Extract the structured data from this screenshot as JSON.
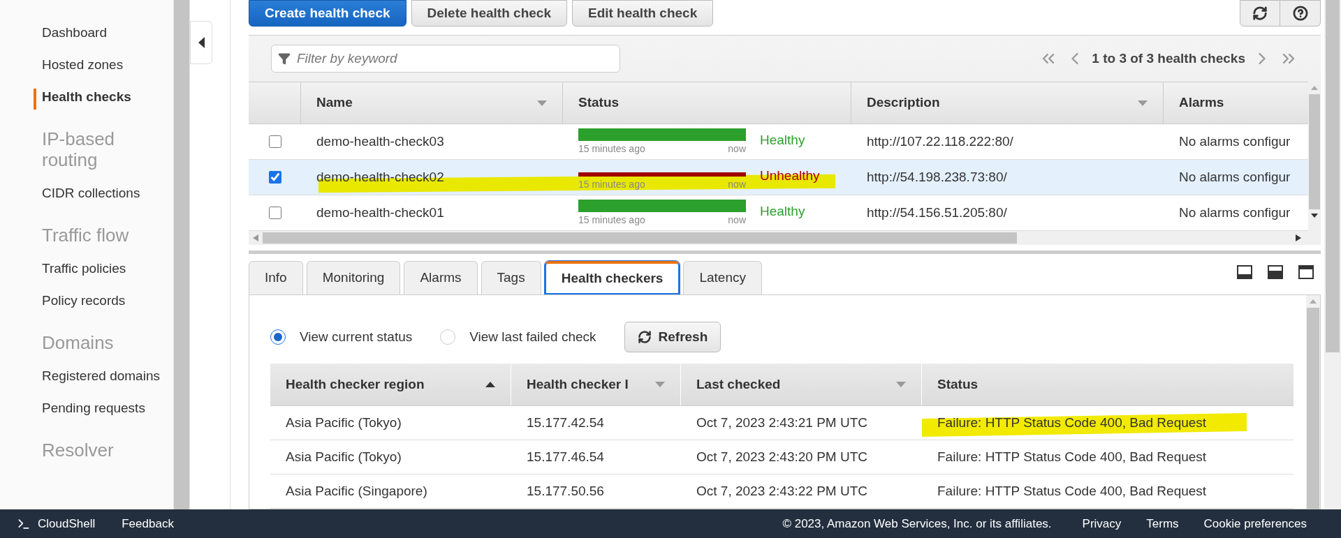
{
  "sidebar": {
    "items": [
      {
        "kind": "link",
        "label": "Dashboard",
        "selected": false
      },
      {
        "kind": "link",
        "label": "Hosted zones",
        "selected": false
      },
      {
        "kind": "link",
        "label": "Health checks",
        "selected": true
      },
      {
        "kind": "heading",
        "label": "IP-based routing"
      },
      {
        "kind": "link",
        "label": "CIDR collections",
        "selected": false
      },
      {
        "kind": "heading",
        "label": "Traffic flow"
      },
      {
        "kind": "link",
        "label": "Traffic policies",
        "selected": false
      },
      {
        "kind": "link",
        "label": "Policy records",
        "selected": false
      },
      {
        "kind": "heading",
        "label": "Domains"
      },
      {
        "kind": "link",
        "label": "Registered domains",
        "selected": false
      },
      {
        "kind": "link",
        "label": "Pending requests",
        "selected": false
      },
      {
        "kind": "heading",
        "label": "Resolver"
      }
    ]
  },
  "toolbar": {
    "buttons": [
      {
        "kind": "primary",
        "label": "Create health check"
      },
      {
        "kind": "default",
        "label": "Delete health check"
      },
      {
        "kind": "default",
        "label": "Edit health check"
      }
    ]
  },
  "table": {
    "filter": {
      "placeholder": "Filter by keyword"
    },
    "pagination": "1 to 3 of 3 health checks",
    "columns": [
      "Name",
      "Status",
      "Description",
      "Alarms"
    ],
    "rows": [
      {
        "checked": false,
        "highlighted": false,
        "name": "demo-health-check03",
        "kind": "healthy",
        "status_label": "Healthy",
        "from": "15 minutes ago",
        "to": "now",
        "description": "http://107.22.118.222:80/",
        "alarms": "No alarms configur"
      },
      {
        "checked": true,
        "highlighted": true,
        "name": "demo-health-check02",
        "kind": "unhealthy",
        "status_label": "Unhealthy",
        "from": "15 minutes ago",
        "to": "now",
        "description": "http://54.198.238.73:80/",
        "alarms": "No alarms configur"
      },
      {
        "checked": false,
        "highlighted": false,
        "name": "demo-health-check01",
        "kind": "healthy",
        "status_label": "Healthy",
        "from": "15 minutes ago",
        "to": "now",
        "description": "http://54.156.51.205:80/",
        "alarms": "No alarms configur"
      }
    ]
  },
  "tabs": [
    {
      "label": "Info",
      "selected": false
    },
    {
      "label": "Monitoring",
      "selected": false
    },
    {
      "label": "Alarms",
      "selected": false
    },
    {
      "label": "Tags",
      "selected": false
    },
    {
      "label": "Health checkers",
      "selected": true
    },
    {
      "label": "Latency",
      "selected": false
    }
  ],
  "view_options": [
    {
      "label": "View current status",
      "selected": true
    },
    {
      "label": "View last failed check",
      "selected": false
    }
  ],
  "refresh_button": "Refresh",
  "checkers": {
    "columns": [
      "Health checker region",
      "Health checker I",
      "Last checked",
      "Status"
    ],
    "rows": [
      {
        "region": "Asia Pacific (Tokyo)",
        "ip": "15.177.42.54",
        "last_checked": "Oct 7, 2023 2:43:21 PM UTC",
        "status": "Failure: HTTP Status Code 400, Bad Request",
        "highlighted": true
      },
      {
        "region": "Asia Pacific (Tokyo)",
        "ip": "15.177.46.54",
        "last_checked": "Oct 7, 2023 2:43:20 PM UTC",
        "status": "Failure: HTTP Status Code 400, Bad Request",
        "highlighted": false
      },
      {
        "region": "Asia Pacific (Singapore)",
        "ip": "15.177.50.56",
        "last_checked": "Oct 7, 2023 2:43:22 PM UTC",
        "status": "Failure: HTTP Status Code 400, Bad Request",
        "highlighted": false
      }
    ]
  },
  "footer": {
    "left": [
      "CloudShell",
      "Feedback"
    ],
    "copyright": "© 2023, Amazon Web Services, Inc. or its affiliates.",
    "links": [
      "Privacy",
      "Terms",
      "Cookie preferences"
    ]
  }
}
